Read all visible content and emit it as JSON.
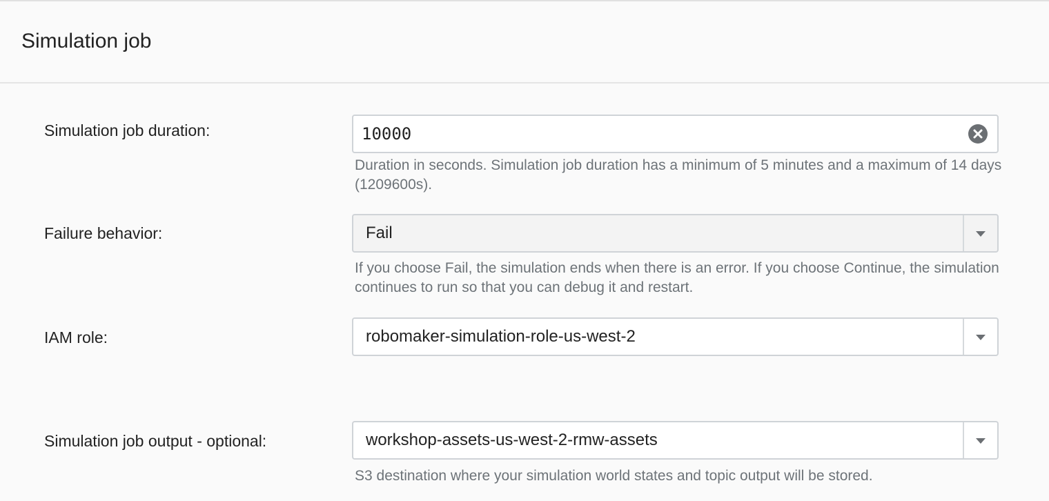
{
  "section": {
    "title": "Simulation job"
  },
  "fields": {
    "duration": {
      "label": "Simulation job duration:",
      "value": "10000",
      "help": "Duration in seconds. Simulation job duration has a minimum of 5 minutes and a maximum of 14 days (1209600s).",
      "clear_icon": "clear-circle-icon"
    },
    "failure_behavior": {
      "label": "Failure behavior:",
      "selected": "Fail",
      "help": "If you choose Fail, the simulation ends when there is an error. If you choose Continue, the simulation continues to run so that you can debug it and restart.",
      "caret_icon": "caret-down-icon"
    },
    "iam_role": {
      "label": "IAM role:",
      "selected": "robomaker-simulation-role-us-west-2",
      "caret_icon": "caret-down-icon"
    },
    "output": {
      "label": "Simulation job output - optional:",
      "selected": "workshop-assets-us-west-2-rmw-assets",
      "help": "S3 destination where your simulation world states and topic output will be stored.",
      "caret_icon": "caret-down-icon"
    }
  },
  "colors": {
    "label_text": "#222222",
    "help_text": "#6d7378",
    "field_border": "#cfd3d7",
    "clear_icon_bg": "#6b6f73",
    "caret": "#6b6f73"
  }
}
